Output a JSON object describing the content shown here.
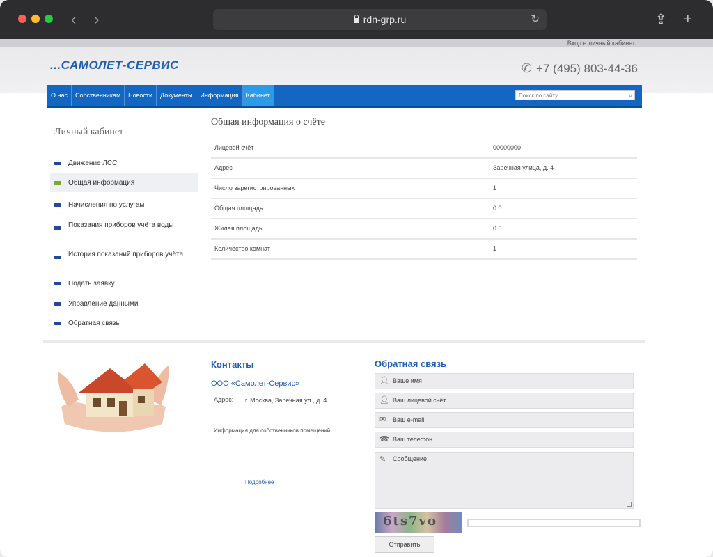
{
  "browser": {
    "url": "rdn-grp.ru"
  },
  "header": {
    "cabinet_link": "Вход в личный кабинет",
    "logo": "...САМОЛЕТ-СЕРВИС",
    "phone": "+7 (495) 803-44-36"
  },
  "nav": {
    "items": [
      {
        "label": "О нас",
        "active": false
      },
      {
        "label": "Собственникам",
        "active": false
      },
      {
        "label": "Новости",
        "active": false
      },
      {
        "label": "Документы",
        "active": false
      },
      {
        "label": "Информация",
        "active": false
      },
      {
        "label": "Кабинет",
        "active": true
      }
    ],
    "search_placeholder": "Поиск по сайту"
  },
  "sidebar": {
    "title": "Личный кабинет",
    "items": [
      {
        "label": "Движение ЛСС",
        "active": false
      },
      {
        "label": "Общая информация",
        "active": true
      },
      {
        "label": "Начисления по услугам",
        "active": false
      },
      {
        "label": "Показания приборов учёта воды",
        "active": false
      },
      {
        "label": "История показаний приборов учёта",
        "active": false
      },
      {
        "label": "Подать заявку",
        "active": false
      },
      {
        "label": "Управление данными",
        "active": false
      },
      {
        "label": "Обратная связь",
        "active": false
      }
    ]
  },
  "main": {
    "title": "Общая информация о счёте",
    "rows": [
      {
        "label": "Лицевой счёт",
        "value": "00000000"
      },
      {
        "label": "Адрес",
        "value": "Заречная улица, д. 4"
      },
      {
        "label": "Число зарегистрированных",
        "value": "1"
      },
      {
        "label": "Общая площадь",
        "value": "0.0"
      },
      {
        "label": "Жилая площадь",
        "value": "0.0"
      },
      {
        "label": "Количество комнат",
        "value": "1"
      }
    ]
  },
  "footer": {
    "contacts_title": "Контакты",
    "company": "ООО «Самолет-Сервис»",
    "address_label": "Адрес:",
    "address": "г. Москва, Заречная ул., д. 4",
    "note": "Информация для собственников помещений.",
    "more_link": "Подробнее",
    "feedback_title": "Обратная связь",
    "fields": [
      {
        "placeholder": "Ваше имя",
        "icon": "user-icon"
      },
      {
        "placeholder": "Ваш лицевой счёт",
        "icon": "user-icon"
      },
      {
        "placeholder": "Ваш e-mail",
        "icon": "envelope-icon"
      },
      {
        "placeholder": "Ваш телефон",
        "icon": "phone-icon"
      }
    ],
    "message_placeholder": "Сообщение",
    "captcha_text": "6ts7vo",
    "submit_label": "Отправить"
  }
}
